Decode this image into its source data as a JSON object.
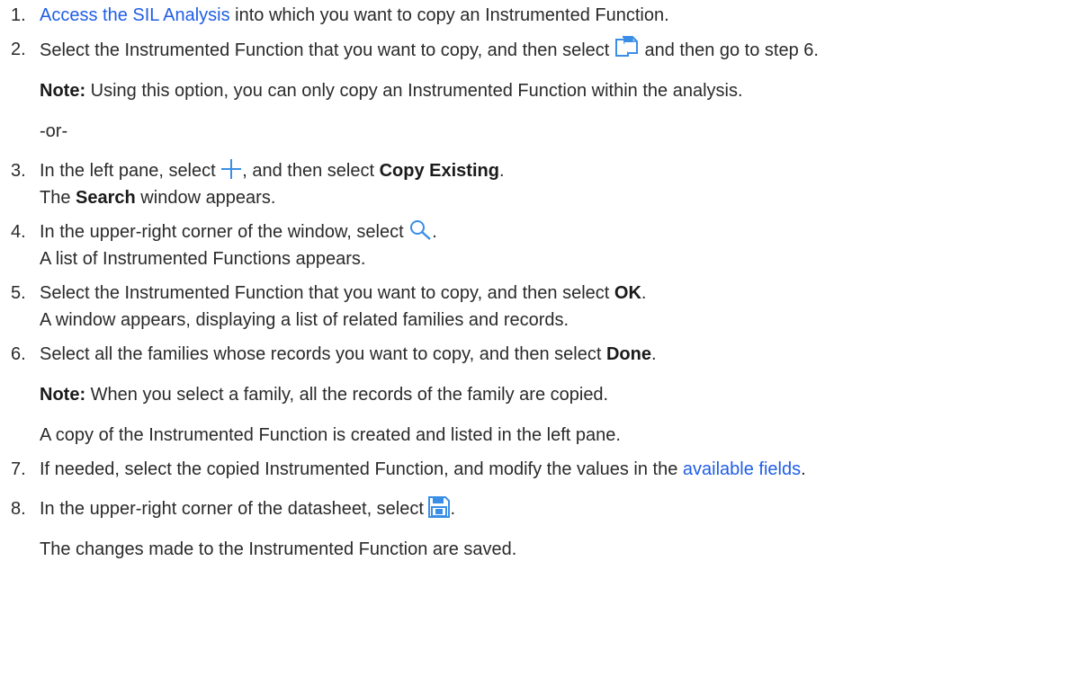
{
  "steps": [
    {
      "num": "1.",
      "link": "Access the SIL Analysis",
      "rest": " into which you want to copy an Instrumented Function."
    },
    {
      "num": "2.",
      "pre": "Select the Instrumented Function that you want to copy, and then select ",
      "icon": "copy-icon",
      "post": " and then go to step 6.",
      "note_label": "Note:",
      "note_text": " Using this option, you can only copy an Instrumented Function within the analysis.",
      "or": "-or-"
    },
    {
      "num": "3.",
      "pre": "In the left pane, select ",
      "icon": "plus-icon",
      "mid": ", and then select ",
      "bold": "Copy Existing",
      "end": ".",
      "line2_pre": "The ",
      "line2_bold": "Search",
      "line2_post": " window appears."
    },
    {
      "num": "4.",
      "pre": "In the upper-right corner of the window, select ",
      "icon": "search-icon",
      "end": ".",
      "line2": "A list of Instrumented Functions appears."
    },
    {
      "num": "5.",
      "pre": "Select the Instrumented Function that you want to copy, and then select ",
      "bold": "OK",
      "end": ".",
      "line2": "A window appears, displaying a list of related families and records."
    },
    {
      "num": "6.",
      "pre": "Select all the families whose records you want to copy, and then select ",
      "bold": "Done",
      "end": ".",
      "note_label": "Note:",
      "note_text": " When you select a family, all the records of the family are copied.",
      "result": "A copy of the Instrumented Function is created and listed in the left pane."
    },
    {
      "num": "7.",
      "pre": "If needed, select the copied Instrumented Function, and modify the values in the ",
      "link": "available fields",
      "end": "."
    },
    {
      "num": "8.",
      "pre": "In the upper-right corner of the datasheet, select ",
      "icon": "save-icon",
      "end": ".",
      "result": "The changes made to the Instrumented Function are saved."
    }
  ],
  "colors": {
    "link": "#1f5ee6",
    "icon_blue": "#3a8ee6",
    "text": "#2a2a2a"
  }
}
